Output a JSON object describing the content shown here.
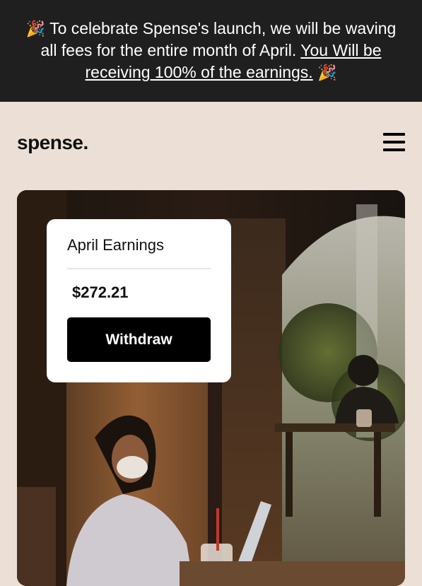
{
  "banner": {
    "emoji_left": "🎉",
    "text": "To celebrate Spense's launch, we will be waving all fees for the entire month of April.",
    "link_text": "You Will be receiving 100% of the earnings.",
    "emoji_right": "🎉"
  },
  "nav": {
    "logo": "spense.",
    "menu_icon": "hamburger-menu-icon"
  },
  "earnings_card": {
    "title": "April Earnings",
    "amount": "$272.21",
    "button_label": "Withdraw"
  },
  "hero_image": {
    "subject": "woman-with-laptop-in-cafe"
  },
  "colors": {
    "banner_bg": "#1f1f1f",
    "page_bg": "#ece0d6",
    "button_bg": "#000000",
    "card_bg": "#ffffff"
  }
}
